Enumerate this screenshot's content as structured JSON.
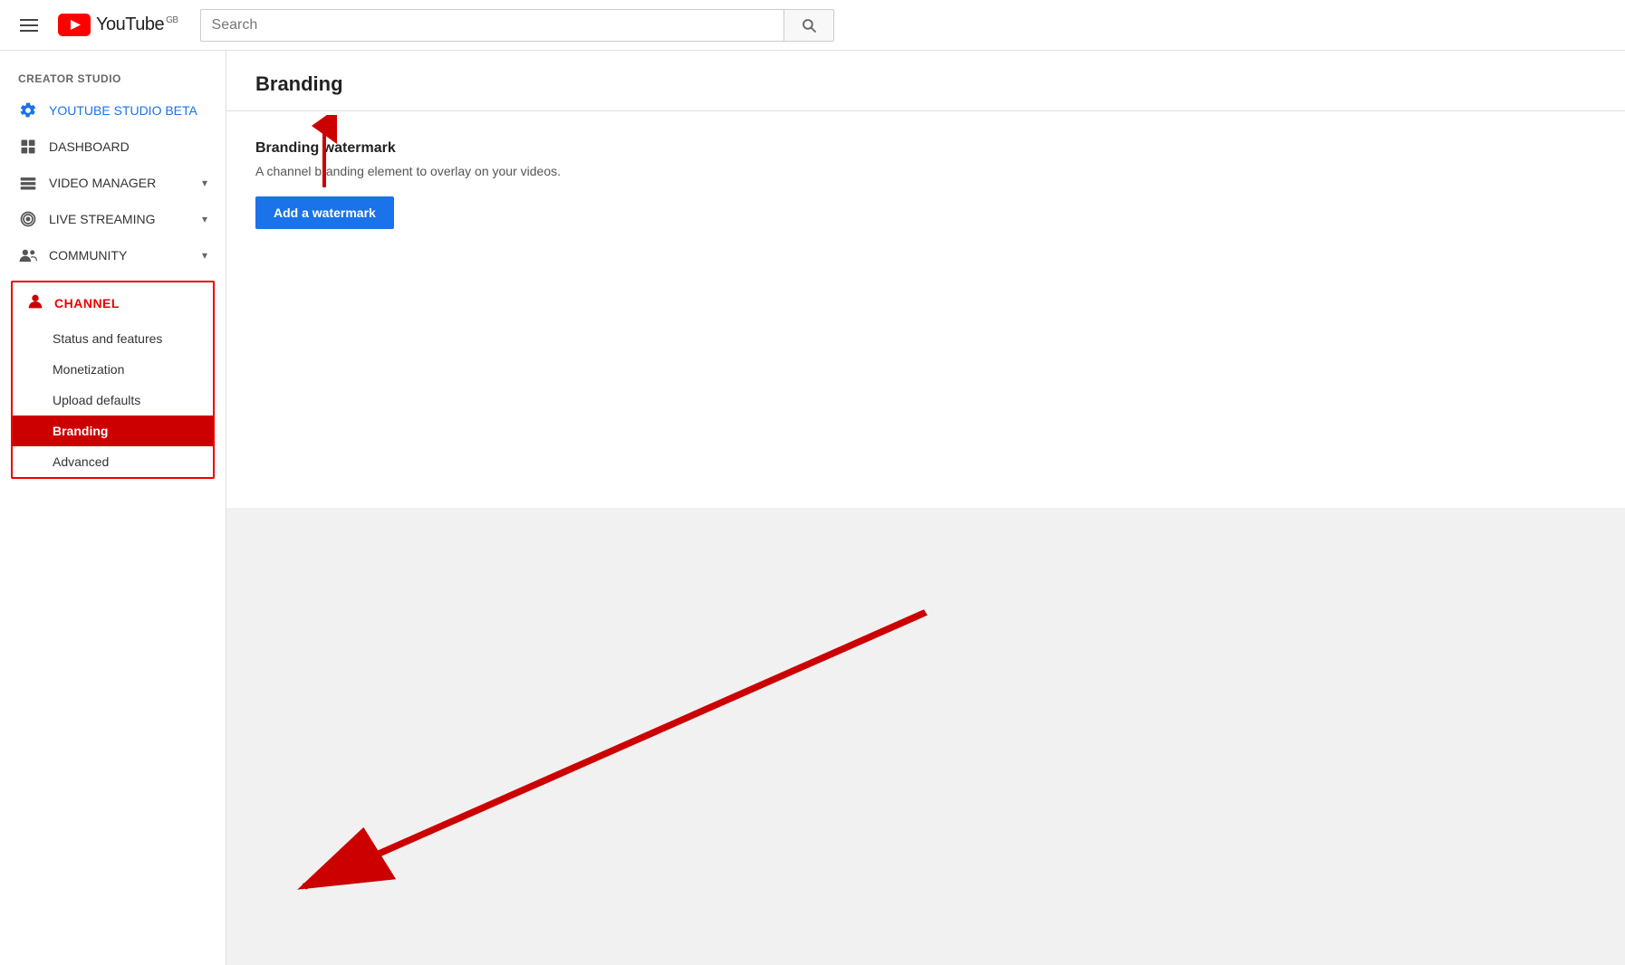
{
  "topnav": {
    "search_placeholder": "Search",
    "yt_gb": "GB"
  },
  "sidebar": {
    "creator_studio_label": "CREATOR STUDIO",
    "items": [
      {
        "id": "studio-beta",
        "label": "YOUTUBE STUDIO BETA",
        "icon": "gear"
      },
      {
        "id": "dashboard",
        "label": "DASHBOARD",
        "icon": "dashboard"
      },
      {
        "id": "video-manager",
        "label": "VIDEO MANAGER",
        "icon": "video-manager",
        "chevron": true
      },
      {
        "id": "live-streaming",
        "label": "LIVE STREAMING",
        "icon": "live-streaming",
        "chevron": true
      },
      {
        "id": "community",
        "label": "COMMUNITY",
        "icon": "community",
        "chevron": true
      }
    ],
    "channel": {
      "label": "CHANNEL",
      "sub_items": [
        {
          "id": "status-features",
          "label": "Status and features"
        },
        {
          "id": "monetization",
          "label": "Monetization"
        },
        {
          "id": "upload-defaults",
          "label": "Upload defaults"
        },
        {
          "id": "branding",
          "label": "Branding",
          "active": true
        },
        {
          "id": "advanced",
          "label": "Advanced"
        }
      ]
    }
  },
  "main": {
    "page_title": "Branding",
    "watermark_section": {
      "subtitle": "Branding watermark",
      "description": "A channel branding element to overlay on your videos.",
      "button_label": "Add a watermark"
    }
  }
}
